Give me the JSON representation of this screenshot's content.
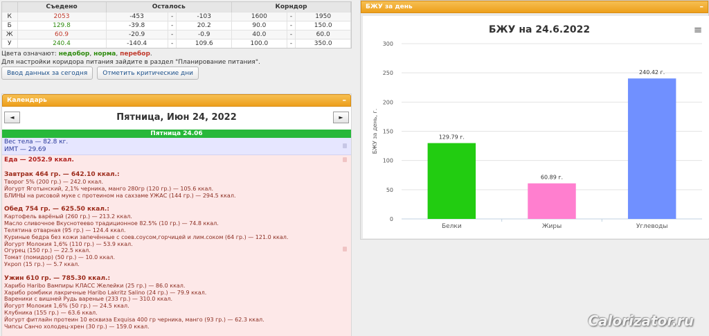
{
  "summary": {
    "headers": [
      "Съедено",
      "Осталось",
      "Корндор"
    ],
    "rows": [
      {
        "label": "К",
        "eaten": "2053",
        "eaten_color": "#c0392b",
        "rem_min": "-453",
        "rem_sep": "-",
        "rem_max": "-103",
        "cor_min": "1600",
        "cor_sep": "-",
        "cor_max": "1950"
      },
      {
        "label": "Б",
        "eaten": "129.8",
        "eaten_color": "#2e8b0e",
        "rem_min": "-39.8",
        "rem_sep": "-",
        "rem_max": "20.2",
        "cor_min": "90.0",
        "cor_sep": "-",
        "cor_max": "150.0"
      },
      {
        "label": "Ж",
        "eaten": "60.9",
        "eaten_color": "#c0392b",
        "rem_min": "-20.9",
        "rem_sep": "-",
        "rem_max": "-0.9",
        "cor_min": "40.0",
        "cor_sep": "-",
        "cor_max": "60.0"
      },
      {
        "label": "У",
        "eaten": "240.4",
        "eaten_color": "#2e8b0e",
        "rem_min": "-140.4",
        "rem_sep": "-",
        "rem_max": "109.6",
        "cor_min": "100.0",
        "cor_sep": "-",
        "cor_max": "350.0"
      }
    ]
  },
  "legend": {
    "prefix": "Цвета означают: ",
    "under": "недобор",
    "sep1": ", ",
    "norm": "норма",
    "sep2": ", ",
    "over": "перебор",
    "suffix": ".",
    "note": "Для настройки коридора питания зайдите в раздел \"Планирование питания\"."
  },
  "buttons": {
    "enter_today": "Ввод данных за сегодня",
    "mark_critical": "Отметить критические дни"
  },
  "calendar": {
    "panel_title": "Календарь",
    "minimize": "–",
    "prev": "◄",
    "next": "►",
    "title": "Пятница, Июн 24, 2022",
    "day_bar": "Пятница 24.06",
    "weight": "Вес тела — 82.8 кг.",
    "bmi": "ИМТ — 29.69",
    "food_total": "Еда — 2052.9 ккал.",
    "meals": [
      {
        "head": "Завтрак 464 гр. — 642.10 ккал.:",
        "items": [
          "Творог 5% (200 гр.) — 242.0 ккал.",
          "Йогурт Яготынский, 2,1% черника, манго 280гр (120 гр.) — 105.6 ккал.",
          "БЛИНЫ на рисовой муке с протеином на сахзаме УЖАС (144 гр.) — 294.5 ккал."
        ]
      },
      {
        "head": "Обед 754 гр. — 625.50 ккал.:",
        "items": [
          "Картофель варёный (260 гр.) — 213.2 ккал.",
          "Масло сливочное Вкуснотеево традиционное 82.5% (10 гр.) — 74.8 ккал.",
          "Телятина отварная (95 гр.) — 124.4 ккал.",
          "Куриные бедра без кожи запечённые с соев.соусом,горчицей и лим.соком (64 гр.) — 121.0 ккал.",
          "Йогурт Молокия 1,6% (110 гр.) — 53.9 ккал.",
          "Огурец (150 гр.) — 22.5 ккал.",
          "Томат (помидор) (50 гр.) — 10.0 ккал.",
          "Укроп (15 гр.) — 5.7 ккал."
        ]
      },
      {
        "head": "Ужин 610 гр. — 785.30 ккал.:",
        "items": [
          "Харибо Haribo Вампиры КЛАСС Желейки (25 гр.) — 86.0 ккал.",
          "Харибо ромбики лакричные Haribo Lakritz Salino (24 гр.) — 79.9 ккал.",
          "Вареники с вишней Рудь вареные (233 гр.) — 310.0 ккал.",
          "Йогурт Молокия 1,6% (50 гр.) — 24.5 ккал.",
          "Клубника (155 гр.) — 63.6 ккал.",
          "Йогурт фитлайн протеин 10 есквиза Exquisa 400 гр черника, манго (93 гр.) — 62.3 ккал.",
          "Чипсы Санчо холодец-хрен (30 гр.) — 159.0 ккал."
        ]
      }
    ]
  },
  "chart_panel": {
    "title": "БЖУ за день",
    "minimize": "–",
    "menu_icon": "≡"
  },
  "chart_data": {
    "type": "bar",
    "title": "БЖУ на 24.6.2022",
    "ylabel": "БЖУ за день, г.",
    "xlabel": "",
    "categories": [
      "Белки",
      "Жиры",
      "Углеводы"
    ],
    "values": [
      129.79,
      60.89,
      240.42
    ],
    "data_labels": [
      "129.79 г.",
      "60.89 г.",
      "240.42 г."
    ],
    "colors": [
      "#22cc11",
      "#ff7fcf",
      "#7090ff"
    ],
    "ylim": [
      0,
      300
    ],
    "yticks": [
      0,
      50,
      100,
      150,
      200,
      250,
      300
    ],
    "grid": true,
    "legend": "none"
  },
  "watermark": "Calorizator.ru"
}
